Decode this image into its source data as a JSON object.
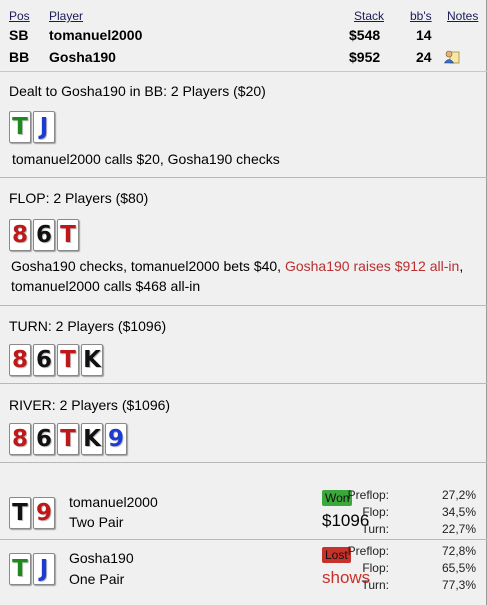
{
  "header": {
    "col_pos": "Pos",
    "col_player": "Player",
    "col_stack": "Stack",
    "col_bbs": "bb's",
    "col_notes": "Notes"
  },
  "players": [
    {
      "pos": "SB",
      "name": "tomanuel2000",
      "stack": "$548",
      "bbs": "14"
    },
    {
      "pos": "BB",
      "name": "Gosha190",
      "stack": "$952",
      "bbs": "24"
    }
  ],
  "preflop": {
    "title": "Dealt to Gosha190 in BB: 2 Players ($20)",
    "cards": [
      {
        "rank": "T",
        "suit": "clubs"
      },
      {
        "rank": "J",
        "suit": "diamonds"
      }
    ],
    "action": "tomanuel2000 calls $20, Gosha190 checks"
  },
  "flop": {
    "title": "FLOP: 2 Players ($80)",
    "cards": [
      {
        "rank": "8",
        "suit": "hearts"
      },
      {
        "rank": "6",
        "suit": "spades"
      },
      {
        "rank": "T",
        "suit": "hearts"
      }
    ],
    "action_a": "Gosha190 checks, tomanuel2000 bets $40, ",
    "action_b": "Gosha190 raises $912 all-in",
    "action_c": ", tomanuel2000 calls $468 all-in"
  },
  "turn": {
    "title": "TURN: 2 Players ($1096)",
    "cards": [
      {
        "rank": "8",
        "suit": "hearts"
      },
      {
        "rank": "6",
        "suit": "spades"
      },
      {
        "rank": "T",
        "suit": "hearts"
      },
      {
        "rank": "K",
        "suit": "spades"
      }
    ]
  },
  "river": {
    "title": "RIVER: 2 Players ($1096)",
    "cards": [
      {
        "rank": "8",
        "suit": "hearts"
      },
      {
        "rank": "6",
        "suit": "spades"
      },
      {
        "rank": "T",
        "suit": "hearts"
      },
      {
        "rank": "K",
        "suit": "spades"
      },
      {
        "rank": "9",
        "suit": "diamonds"
      }
    ]
  },
  "results": [
    {
      "name": "tomanuel2000",
      "hand": "Two Pair",
      "cards": [
        {
          "rank": "T",
          "suit": "spades"
        },
        {
          "rank": "9",
          "suit": "hearts"
        }
      ],
      "badge": "Won",
      "amount": "$1096",
      "eq_labels": [
        "Preflop:",
        "Flop:",
        "Turn:"
      ],
      "eq_values": [
        "27,2%",
        "34,5%",
        "22,7%"
      ]
    },
    {
      "name": "Gosha190",
      "hand": "One Pair",
      "cards": [
        {
          "rank": "T",
          "suit": "clubs"
        },
        {
          "rank": "J",
          "suit": "diamonds"
        }
      ],
      "badge": "Lost",
      "amount": "shows",
      "eq_labels": [
        "Preflop:",
        "Flop:",
        "Turn:"
      ],
      "eq_values": [
        "72,8%",
        "65,5%",
        "77,3%"
      ]
    }
  ],
  "colors": {
    "hearts": "#c01818",
    "spades": "#111111",
    "clubs": "#1e8a1e",
    "diamonds": "#1d3bd1",
    "won": "#3aa83a",
    "lost": "#c8302a",
    "raise_text": "#b83030"
  },
  "icons": {
    "notes": "person-note-icon"
  }
}
